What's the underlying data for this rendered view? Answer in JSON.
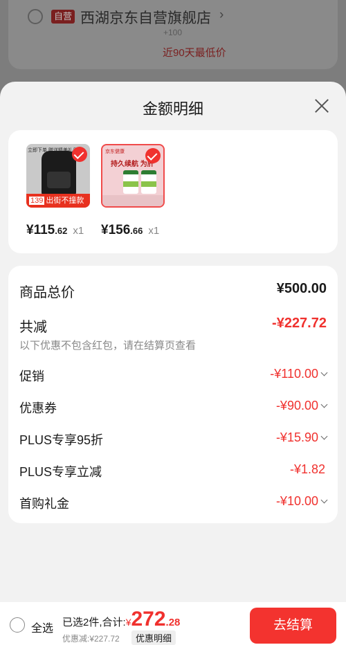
{
  "background": {
    "self_badge": "自营",
    "store_name": "西湖京东自营旗舰店",
    "store_chevron": "›",
    "price_cut_snippet": "+100",
    "lowest_price_label": "近90天最低价"
  },
  "sheet": {
    "title": "金额明细",
    "products": [
      {
        "thumb_label": "出街不撞款",
        "thumb_price_tag": "139",
        "thumb_top_text": "立即下单 赠送精美礼品",
        "price_int": "¥115",
        "price_dec": ".62",
        "qty": "x1"
      },
      {
        "thumb_header": "京东健康",
        "thumb_title": "持久续航 为肝",
        "price_int": "¥156",
        "price_dec": ".66",
        "qty": "x1"
      }
    ],
    "summary": {
      "total_label": "商品总价",
      "total_value": "¥500.00",
      "discount_label": "共减",
      "discount_value": "-¥227.72",
      "note": "以下优惠不包含红包，请在结算页查看"
    },
    "breakdown": [
      {
        "label": "促销",
        "value": "-¥110.00",
        "has_chevron": true
      },
      {
        "label": "优惠券",
        "value": "-¥90.00",
        "has_chevron": true
      },
      {
        "label": "PLUS专享95折",
        "value": "-¥15.90",
        "has_chevron": true
      },
      {
        "label": "PLUS专享立减",
        "value": "-¥1.82",
        "has_chevron": false
      },
      {
        "label": "首购礼金",
        "value": "-¥10.00",
        "has_chevron": true
      }
    ]
  },
  "footer": {
    "select_all": "全选",
    "selected_prefix": "已选2件,合计:",
    "currency": "¥",
    "total_int": "272",
    "total_dec": ".28",
    "saved": "优惠减:¥227.72",
    "detail_link": "优惠明细",
    "checkout_button": "去结算"
  },
  "colors": {
    "accent_red": "#f0312e",
    "sheet_bg": "#f2f2f2"
  }
}
